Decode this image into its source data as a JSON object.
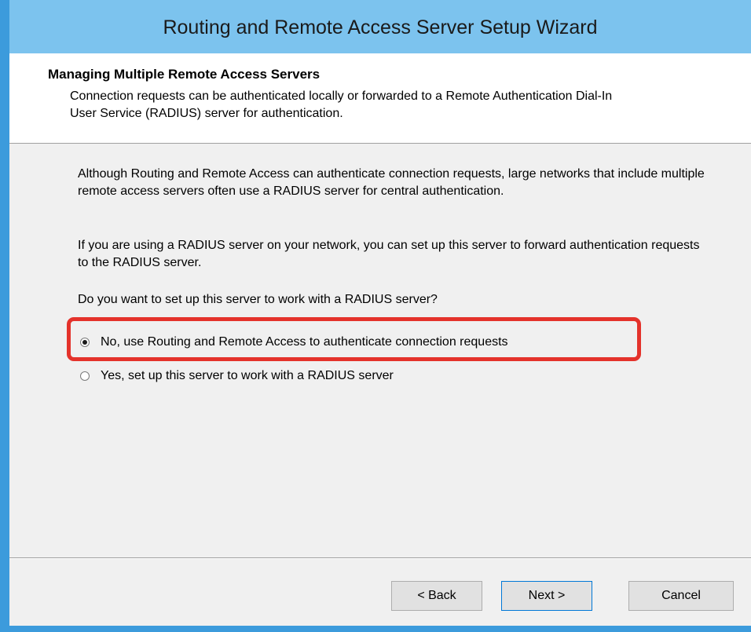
{
  "window": {
    "title": "Routing and Remote Access Server Setup Wizard"
  },
  "header": {
    "title": "Managing Multiple Remote Access Servers",
    "subtitle": "Connection requests can be authenticated locally or forwarded to a Remote Authentication Dial-In User Service (RADIUS) server for authentication."
  },
  "body": {
    "paragraph1": "Although Routing and Remote Access can authenticate connection requests, large networks that include multiple remote access servers often use a RADIUS server for central authentication.",
    "paragraph2": "If you are using a RADIUS server on your network, you can set up this server to forward authentication requests to the RADIUS server.",
    "question": "Do you want to set up this server to work with a RADIUS server?"
  },
  "options": [
    {
      "label": "No, use Routing and Remote Access to authenticate connection requests",
      "checked": true
    },
    {
      "label": "Yes, set up this server to work with a RADIUS server",
      "checked": false
    }
  ],
  "buttons": {
    "back": "< Back",
    "next": "Next >",
    "cancel": "Cancel"
  },
  "colors": {
    "titlebar": "#7cc3ee",
    "window_border": "#3c9bdc",
    "highlight": "#e4322b"
  }
}
